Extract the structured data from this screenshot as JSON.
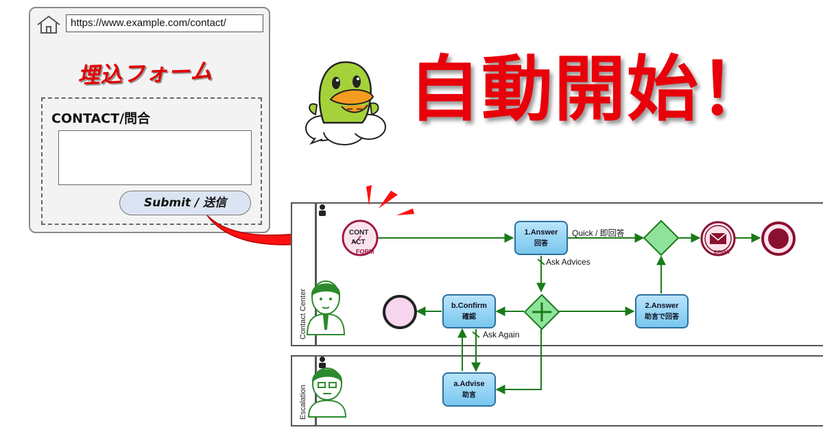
{
  "browser": {
    "url": "https://www.example.com/contact/",
    "embed_title": "埋込フォーム",
    "form_label": "CONTACT/問合",
    "submit_label": "Submit / 送信"
  },
  "headline": "自動開始！",
  "diagram": {
    "lanes": [
      {
        "name": "Contact Center"
      },
      {
        "name": "Escalation"
      }
    ],
    "start_event": {
      "line1": "CONT",
      "line2": "ACT",
      "caption": "FORM"
    },
    "tasks": {
      "answer1": {
        "title": "1.Answer",
        "sub": "回答"
      },
      "answer2": {
        "title": "2.Answer",
        "sub": "助言で回答"
      },
      "confirm": {
        "title": "b.Confirm",
        "sub": "確認"
      },
      "advise": {
        "title": "a.Advise",
        "sub": "助言"
      }
    },
    "flow_labels": {
      "quick": "Quick / 即回答",
      "ask_advices": "Ask Advices",
      "ask_again": "Ask Again"
    },
    "email_caption": "email"
  },
  "colors": {
    "accent_red": "#e8000a",
    "flow_green": "#1a7a1a",
    "gateway_green": "#8fe29a",
    "task_blue": "#78c6ee"
  }
}
